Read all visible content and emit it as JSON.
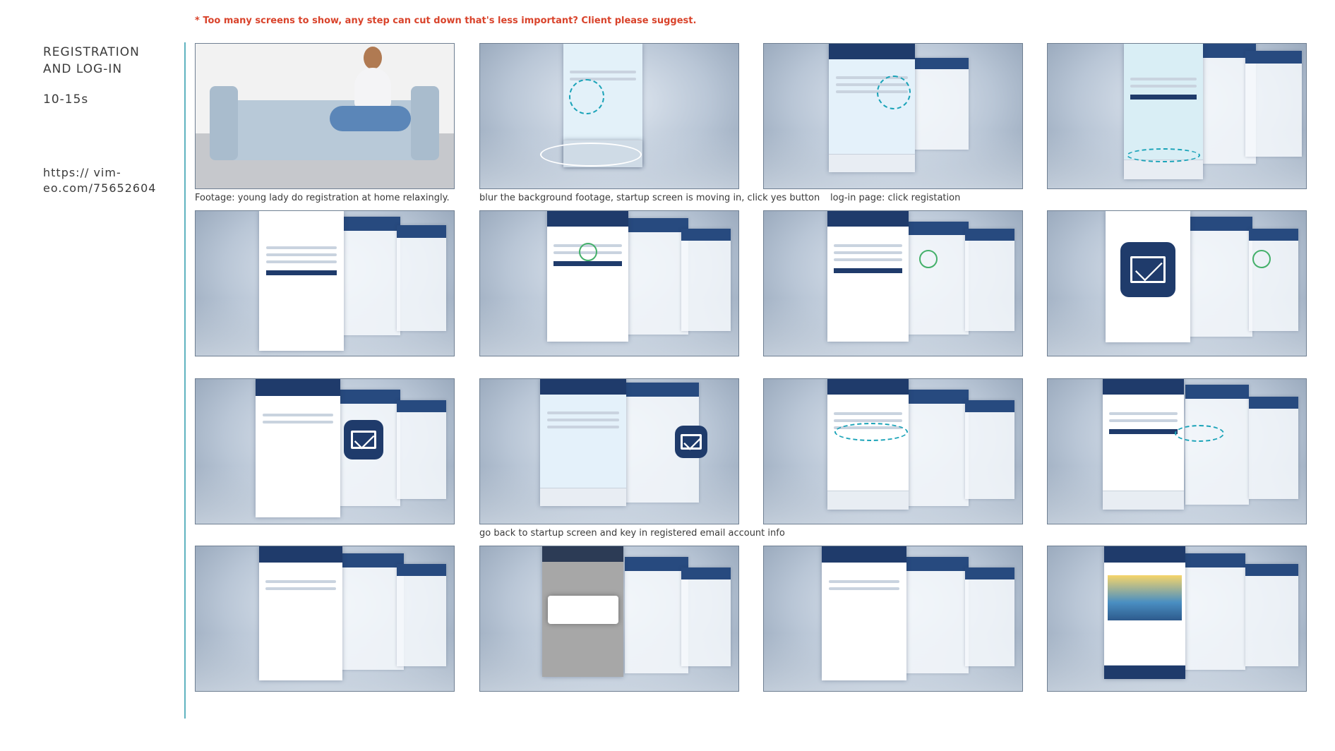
{
  "note": "* Too many screens to show, any step can cut down that's less important? Client please suggest.",
  "sidebar": {
    "title": "REGISTRATION AND LOG-IN",
    "duration": "10-15s",
    "link": "https:// vim-eo.com/75652604"
  },
  "captions": {
    "c1": "Footage: young lady do registration at home relaxingly.",
    "c2": "blur the background footage, startup screen is moving in, click yes button",
    "c3": "log-in page: click registation",
    "c4": "go back to startup screen and key in registered email account info"
  },
  "colors": {
    "accent_red": "#d9432b",
    "divider": "#5fb3c0",
    "app_navy": "#1f3b6b"
  }
}
